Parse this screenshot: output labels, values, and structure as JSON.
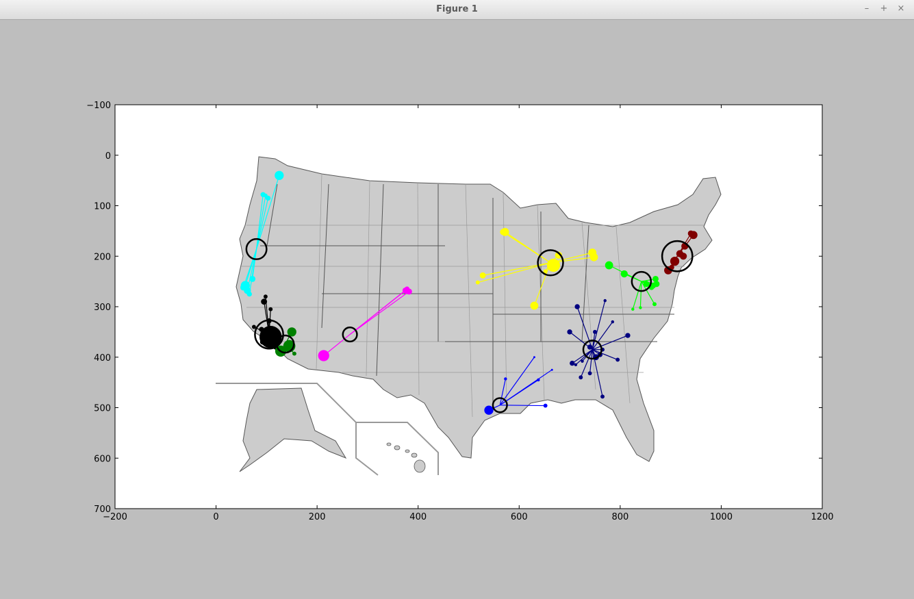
{
  "window": {
    "title": "Figure 1",
    "minimize_icon": "minus-icon",
    "maximize_icon": "plus-icon",
    "close_icon": "close-icon",
    "minimize_label": "–",
    "maximize_label": "+",
    "close_label": "×"
  },
  "chart_data": {
    "type": "scatter",
    "title": "",
    "xlabel": "",
    "ylabel": "",
    "xlim": [
      -200,
      1200
    ],
    "ylim": [
      700,
      -100
    ],
    "y_inverted": true,
    "grid": false,
    "background_image": "us-county-map",
    "xticks": [
      -200,
      0,
      200,
      400,
      600,
      800,
      1000,
      1200
    ],
    "yticks": [
      -100,
      0,
      100,
      200,
      300,
      400,
      500,
      600,
      700
    ],
    "xtick_labels": [
      "−200",
      "0",
      "200",
      "400",
      "600",
      "800",
      "1000",
      "1200"
    ],
    "ytick_labels": [
      "−100",
      "0",
      "100",
      "200",
      "300",
      "400",
      "500",
      "600",
      "700"
    ],
    "map_color": "#cccccc",
    "series": [
      {
        "color": "#00ffff",
        "centroid": [
          80,
          186
        ],
        "centroid_r": 20,
        "points": [
          [
            125,
            40,
            9
          ],
          [
            93,
            78,
            5
          ],
          [
            103,
            85,
            5
          ],
          [
            98,
            80,
            4
          ],
          [
            72,
            245,
            6
          ],
          [
            58,
            258,
            9
          ],
          [
            62,
            268,
            7
          ],
          [
            66,
            275,
            5
          ],
          [
            54,
            262,
            6
          ]
        ]
      },
      {
        "color": "#000000",
        "centroid": [
          105,
          355
        ],
        "centroid_r": 28,
        "points": [
          [
            95,
            290,
            6
          ],
          [
            98,
            280,
            4
          ],
          [
            108,
            305,
            4
          ],
          [
            105,
            328,
            5
          ],
          [
            75,
            340,
            4
          ],
          [
            90,
            345,
            5
          ],
          [
            108,
            360,
            22
          ],
          [
            118,
            380,
            5
          ],
          [
            92,
            370,
            5
          ]
        ]
      },
      {
        "color": "#008000",
        "centroid": [
          137,
          374
        ],
        "centroid_r": 17,
        "points": [
          [
            150,
            350,
            9
          ],
          [
            145,
            378,
            12
          ],
          [
            128,
            388,
            11
          ],
          [
            155,
            393,
            4
          ]
        ]
      },
      {
        "color": "#ff00ff",
        "centroid": [
          265,
          355
        ],
        "centroid_r": 14,
        "points": [
          [
            213,
            397,
            11
          ],
          [
            375,
            268,
            6
          ],
          [
            382,
            270,
            6
          ],
          [
            378,
            265,
            5
          ]
        ]
      },
      {
        "color": "#ffff00",
        "centroid": [
          662,
          213
        ],
        "centroid_r": 25,
        "points": [
          [
            572,
            152,
            8
          ],
          [
            568,
            152,
            6
          ],
          [
            528,
            238,
            6
          ],
          [
            518,
            252,
            4
          ],
          [
            630,
            298,
            8
          ],
          [
            678,
            198,
            7
          ],
          [
            668,
            218,
            13
          ],
          [
            652,
            230,
            4
          ],
          [
            745,
            193,
            8
          ],
          [
            748,
            202,
            8
          ]
        ]
      },
      {
        "color": "#00ff00",
        "centroid": [
          842,
          250
        ],
        "centroid_r": 19,
        "points": [
          [
            778,
            218,
            8
          ],
          [
            808,
            235,
            7
          ],
          [
            870,
            245,
            6
          ],
          [
            865,
            258,
            6
          ],
          [
            862,
            262,
            5
          ],
          [
            852,
            255,
            6
          ],
          [
            872,
            255,
            6
          ],
          [
            868,
            295,
            4
          ],
          [
            825,
            305,
            3
          ],
          [
            840,
            302,
            3
          ]
        ]
      },
      {
        "color": "#800000",
        "centroid": [
          913,
          200
        ],
        "centroid_r": 30,
        "points": [
          [
            945,
            158,
            8
          ],
          [
            940,
            155,
            6
          ],
          [
            928,
            180,
            7
          ],
          [
            918,
            195,
            7
          ],
          [
            908,
            210,
            9
          ],
          [
            925,
            200,
            7
          ],
          [
            895,
            228,
            8
          ],
          [
            902,
            222,
            5
          ]
        ]
      },
      {
        "color": "#000080",
        "centroid": [
          745,
          385
        ],
        "centroid_r": 18,
        "points": [
          [
            715,
            300,
            5
          ],
          [
            700,
            350,
            5
          ],
          [
            770,
            288,
            3
          ],
          [
            785,
            330,
            3
          ],
          [
            815,
            357,
            5
          ],
          [
            750,
            350,
            4
          ],
          [
            740,
            380,
            5
          ],
          [
            705,
            412,
            5
          ],
          [
            712,
            415,
            3
          ],
          [
            725,
            408,
            3
          ],
          [
            722,
            440,
            4
          ],
          [
            740,
            432,
            4
          ],
          [
            760,
            395,
            5
          ],
          [
            765,
            385,
            4
          ],
          [
            795,
            405,
            4
          ],
          [
            765,
            478,
            4
          ],
          [
            752,
            400,
            6
          ]
        ]
      },
      {
        "color": "#0000ff",
        "centroid": [
          562,
          495
        ],
        "centroid_r": 14,
        "points": [
          [
            540,
            505,
            9
          ],
          [
            573,
            443,
            3
          ],
          [
            630,
            400,
            2
          ],
          [
            638,
            445,
            3
          ],
          [
            665,
            425,
            2
          ],
          [
            652,
            496,
            4
          ]
        ]
      }
    ]
  }
}
